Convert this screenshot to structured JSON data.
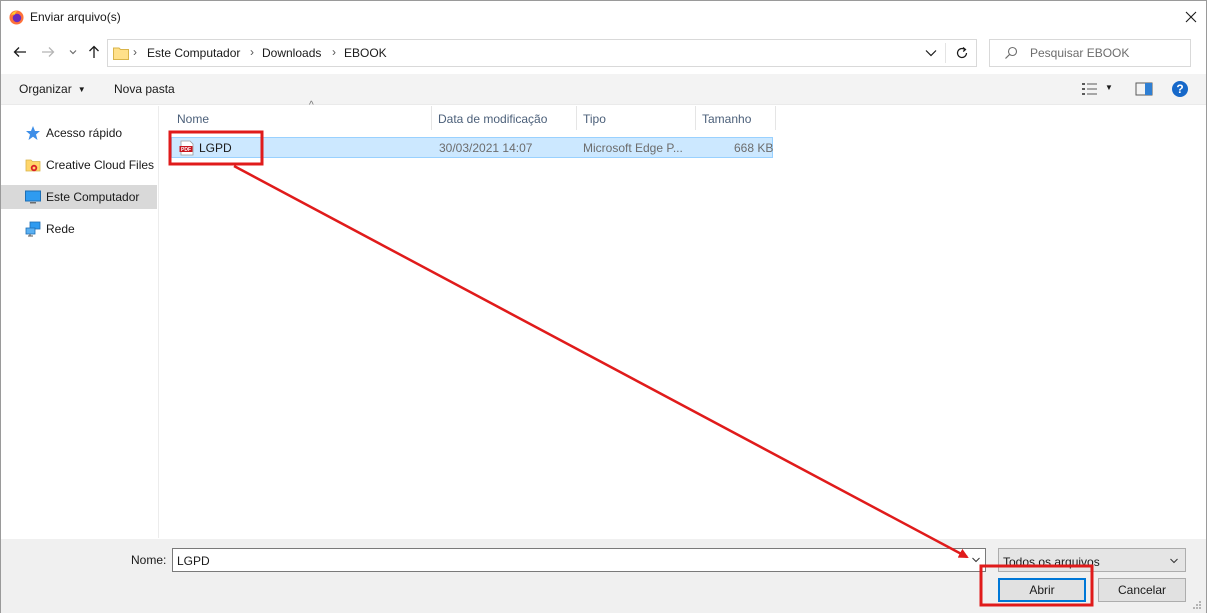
{
  "window": {
    "title": "Enviar arquivo(s)"
  },
  "address_bar": {
    "breadcrumbs": [
      "Este Computador",
      "Downloads",
      "EBOOK"
    ]
  },
  "search": {
    "placeholder": "Pesquisar EBOOK"
  },
  "toolbar": {
    "organize_label": "Organizar",
    "new_folder_label": "Nova pasta"
  },
  "sidebar": {
    "items": [
      {
        "label": "Acesso rápido",
        "icon": "star-icon",
        "selected": false
      },
      {
        "label": "Creative Cloud Files",
        "icon": "creative-cloud-folder-icon",
        "selected": false
      },
      {
        "label": "Este Computador",
        "icon": "computer-icon",
        "selected": true
      },
      {
        "label": "Rede",
        "icon": "network-icon",
        "selected": false
      }
    ]
  },
  "file_list": {
    "columns": [
      "Nome",
      "Data de modificação",
      "Tipo",
      "Tamanho"
    ],
    "rows": [
      {
        "name": "LGPD",
        "modified": "30/03/2021 14:07",
        "type": "Microsoft Edge P...",
        "size": "668 KB",
        "icon": "pdf-icon",
        "selected": true
      }
    ]
  },
  "footer": {
    "name_label": "Nome:",
    "name_value": "LGPD",
    "file_type": "Todos os arquivos",
    "open_label": "Abrir",
    "cancel_label": "Cancelar"
  },
  "colors": {
    "selection_fill": "#cce8ff",
    "selection_border": "#99d1ff",
    "annotation": "#e01b1b",
    "primary_button_border": "#0078d7"
  }
}
